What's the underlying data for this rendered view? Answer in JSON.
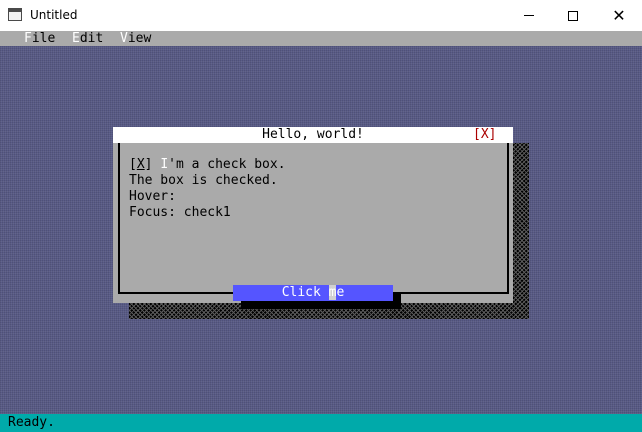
{
  "window": {
    "title": "Untitled",
    "minimize_glyph": "",
    "maximize_glyph": "",
    "close_glyph": "✕"
  },
  "menu": {
    "items": [
      {
        "hotkey": "F",
        "rest": "ile"
      },
      {
        "hotkey": "E",
        "rest": "dit"
      },
      {
        "hotkey": "V",
        "rest": "iew"
      }
    ]
  },
  "dialog": {
    "title": "Hello, world!",
    "close_label": "[X]",
    "checkbox": {
      "open": "[",
      "mark": "X",
      "close": "]",
      "hotkey": "I",
      "rest": "'m a check box."
    },
    "status_line": "The box is checked.",
    "hover_line": "Hover:",
    "focus_line": "Focus: check1",
    "button": {
      "before": "Click ",
      "cursor": "m",
      "after": "e"
    }
  },
  "statusbar": {
    "text": "Ready."
  },
  "colors": {
    "desktop": "#585a86",
    "menubar": "#aaaaaa",
    "dialog_bg": "#aaaaaa",
    "button_bg": "#5555ff",
    "statusbar": "#00aaaa",
    "close_red": "#aa0000"
  }
}
